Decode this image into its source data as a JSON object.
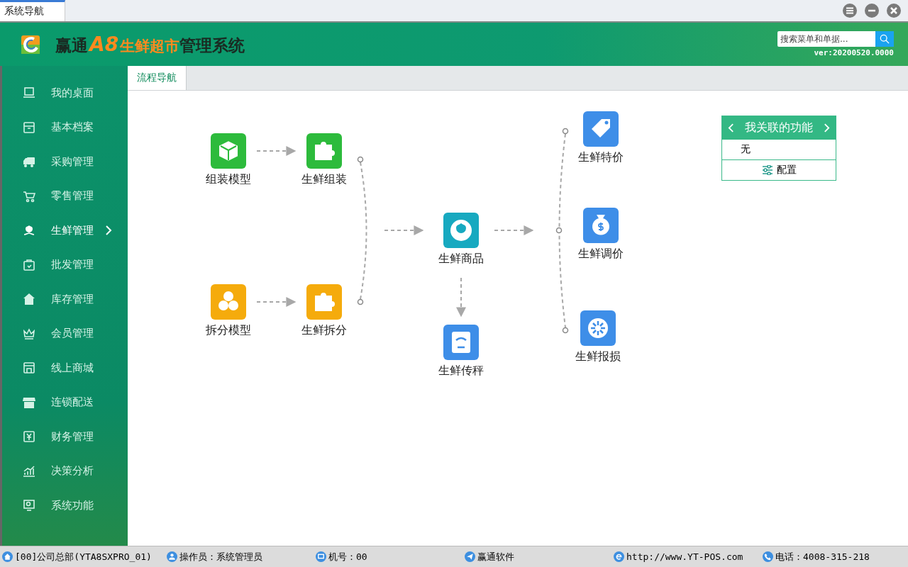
{
  "window": {
    "tab": "系统导航"
  },
  "header": {
    "brand_a": "赢通",
    "brand_b": "A8",
    "brand_c": "生鲜超市",
    "brand_d": "管理系统",
    "search": {
      "placeholder": "搜索菜单和单据..."
    },
    "version": "ver:20200520.0000"
  },
  "sidebar": {
    "items": [
      {
        "label": "我的桌面",
        "kind": "desktop",
        "selected": false
      },
      {
        "label": "基本档案",
        "kind": "archive",
        "selected": false
      },
      {
        "label": "采购管理",
        "kind": "truck",
        "selected": false
      },
      {
        "label": "零售管理",
        "kind": "cart",
        "selected": false
      },
      {
        "label": "生鲜管理",
        "kind": "flower",
        "selected": true
      },
      {
        "label": "批发管理",
        "kind": "bag",
        "selected": false
      },
      {
        "label": "库存管理",
        "kind": "house",
        "selected": false
      },
      {
        "label": "会员管理",
        "kind": "crown",
        "selected": false
      },
      {
        "label": "线上商城",
        "kind": "shop",
        "selected": false
      },
      {
        "label": "连锁配送",
        "kind": "store",
        "selected": false
      },
      {
        "label": "财务管理",
        "kind": "yen",
        "selected": false
      },
      {
        "label": "决策分析",
        "kind": "chart",
        "selected": false
      },
      {
        "label": "系统功能",
        "kind": "monitor",
        "selected": false
      }
    ]
  },
  "tabs": [
    {
      "label": "流程导航",
      "selected": true
    }
  ],
  "flow": {
    "nodes": [
      {
        "label": "组装模型",
        "kind": "cube",
        "color": "#2dbb3c"
      },
      {
        "label": "生鲜组装",
        "kind": "puzzle",
        "color": "#2dbb3c"
      },
      {
        "label": "拆分模型",
        "kind": "hexagons",
        "color": "#f5ab0c"
      },
      {
        "label": "生鲜拆分",
        "kind": "puzzle",
        "color": "#f5ab0c"
      },
      {
        "label": "生鲜商品",
        "kind": "flower",
        "color": "#17a9c0"
      },
      {
        "label": "生鲜传秤",
        "kind": "scale",
        "color": "#3e8ee8"
      },
      {
        "label": "生鲜特价",
        "kind": "tag",
        "color": "#3e8ee8"
      },
      {
        "label": "生鲜调价",
        "kind": "money",
        "color": "#3e8ee8"
      },
      {
        "label": "生鲜报损",
        "kind": "wheel",
        "color": "#3e8ee8"
      }
    ]
  },
  "related": {
    "title": "我关联的功能",
    "items": [
      "无"
    ],
    "config_button": "配置"
  },
  "status_bar": [
    {
      "text": "[00]公司总部(YTA8SXPRO_01)",
      "kind": "home"
    },
    {
      "text": "操作员：系统管理员",
      "kind": "user"
    },
    {
      "text": "机号：00",
      "kind": "screen"
    },
    {
      "text": "赢通软件",
      "kind": "send"
    },
    {
      "text": "http://www.YT-POS.com",
      "kind": "web"
    },
    {
      "text": "电话：4008-315-218",
      "kind": "phone"
    }
  ]
}
